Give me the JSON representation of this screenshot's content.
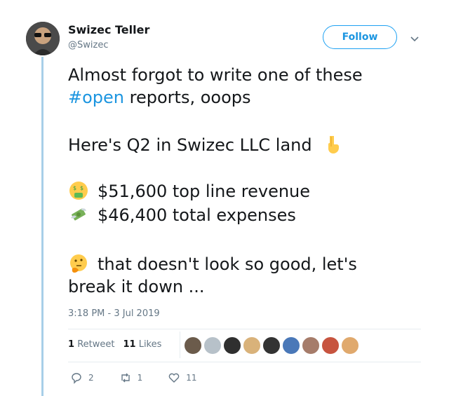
{
  "author": {
    "name": "Swizec Teller",
    "handle": "@Swizec"
  },
  "follow_label": "Follow",
  "tweet": {
    "line1": "Almost forgot to write one of these",
    "hashtag": "#open",
    "line2_rest": " reports, ooops",
    "line3": "Here's Q2 in Swizec LLC land",
    "revenue": "$51,600 top line revenue",
    "expenses": "$46,400 total expenses",
    "line6": "that doesn't look so good, let's",
    "line7": "break it down ..."
  },
  "timestamp": "3:18 PM - 3 Jul 2019",
  "stats": {
    "retweets_count": "1",
    "retweets_label": "Retweet",
    "likes_count": "11",
    "likes_label": "Likes"
  },
  "actions": {
    "replies": "2",
    "retweets": "1",
    "likes": "11"
  },
  "icons": [
    "chevron-down-icon",
    "pointing-down-emoji",
    "money-mouth-emoji",
    "money-wings-emoji",
    "thinking-face-emoji",
    "reply-icon",
    "retweet-icon",
    "heart-icon"
  ],
  "colors": {
    "accent": "#1da1f2",
    "link": "#1b95e0",
    "thread": "#a8cfe8",
    "muted": "#657786"
  }
}
